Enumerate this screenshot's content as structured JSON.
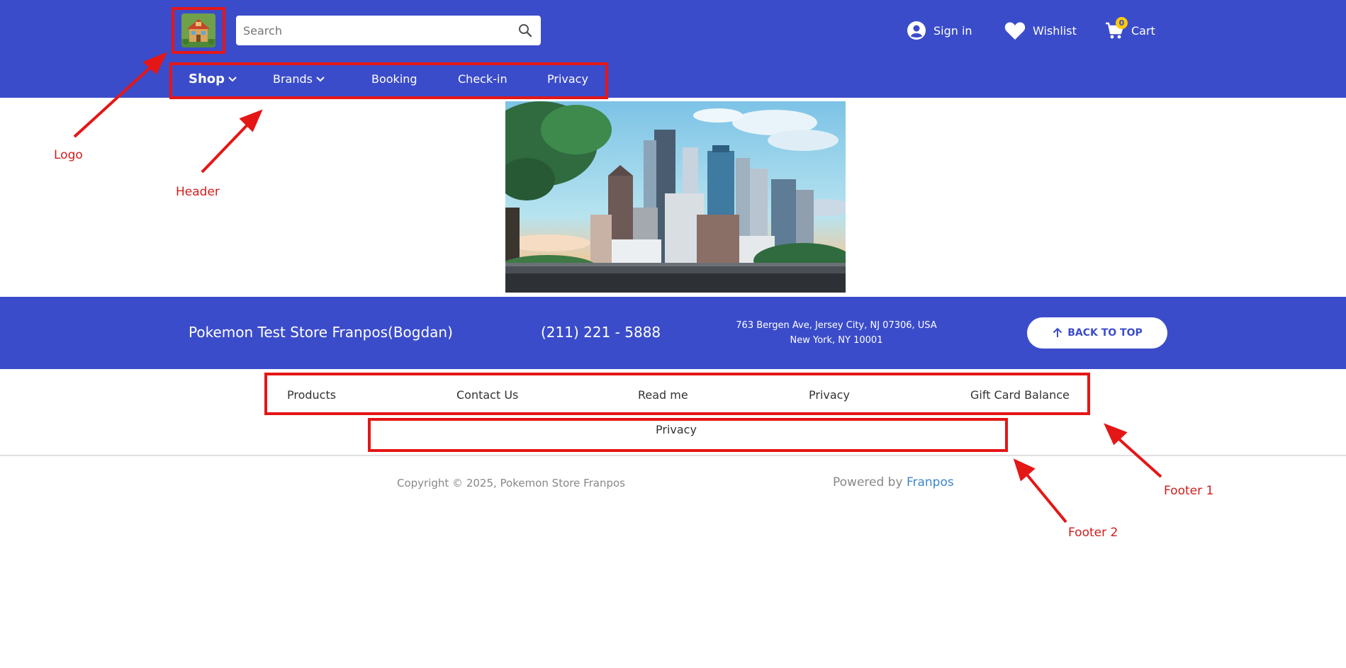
{
  "header": {
    "logo_alt": "Store logo",
    "search_placeholder": "Search",
    "sign_in": "Sign in",
    "wishlist": "Wishlist",
    "cart": "Cart",
    "cart_count": "0",
    "nav": [
      {
        "label": "Shop",
        "has_dropdown": true
      },
      {
        "label": "Brands",
        "has_dropdown": true
      },
      {
        "label": "Booking",
        "has_dropdown": false
      },
      {
        "label": "Check-in",
        "has_dropdown": false
      },
      {
        "label": "Privacy",
        "has_dropdown": false
      }
    ]
  },
  "annotations": {
    "logo": "Logo",
    "header": "Header",
    "footer1": "Footer 1",
    "footer2": "Footer 2",
    "color": "#e51616"
  },
  "footer": {
    "store_name": "Pokemon Test Store Franpos(Bogdan)",
    "phone": "(211) 221 - 5888",
    "address_line1": "763 Bergen Ave, Jersey City, NJ 07306, USA",
    "address_line2": "New York, NY 10001",
    "back_to_top": "BACK TO TOP",
    "links1": [
      "Products",
      "Contact Us",
      "Read me",
      "Privacy",
      "Gift Card Balance"
    ],
    "links2": [
      "Privacy"
    ],
    "copyright": "Copyright © 2025, Pokemon Store Franpos",
    "powered_by": "Powered by ",
    "powered_brand": "Franpos"
  },
  "colors": {
    "brand_blue": "#3b4cca",
    "badge_yellow": "#ffcb05",
    "link_blue": "#3a86c8"
  }
}
